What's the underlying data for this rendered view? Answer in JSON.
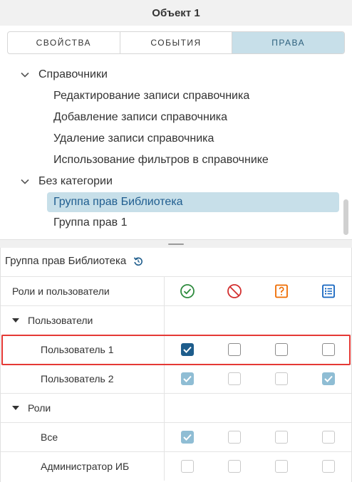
{
  "header": {
    "title": "Объект 1"
  },
  "tabs": [
    {
      "label": "СВОЙСТВА",
      "active": false
    },
    {
      "label": "СОБЫТИЯ",
      "active": false
    },
    {
      "label": "ПРАВА",
      "active": true
    }
  ],
  "tree": {
    "groups": [
      {
        "label": "Справочники",
        "items": [
          "Редактирование записи справочника",
          "Добавление записи справочника",
          "Удаление записи справочника",
          "Использование фильтров в справочнике"
        ]
      },
      {
        "label": "Без категории",
        "items": [
          "Группа прав Библиотека",
          "Группа прав 1"
        ],
        "selected_item": "Группа прав Библиотека"
      }
    ]
  },
  "panel": {
    "title": "Группа прав Библиотека",
    "columns_header": "Роли и пользователи",
    "column_icons": [
      "allow-icon",
      "deny-icon",
      "ask-icon",
      "list-icon"
    ],
    "colors": {
      "allow": "#2e8b3e",
      "deny": "#d32f2f",
      "ask": "#ef6c00",
      "list": "#1565c0",
      "accent": "#1e5d8c",
      "highlight": "#e53935"
    },
    "rows": [
      {
        "type": "group",
        "label": "Пользователи"
      },
      {
        "type": "item",
        "label": "Пользователь 1",
        "checks": [
          true,
          false,
          false,
          false
        ],
        "dim": false,
        "highlighted": true
      },
      {
        "type": "item",
        "label": "Пользователь 2",
        "checks": [
          true,
          false,
          false,
          true
        ],
        "dim": true
      },
      {
        "type": "group",
        "label": "Роли"
      },
      {
        "type": "item",
        "label": "Все",
        "checks": [
          true,
          false,
          false,
          false
        ],
        "dim": true
      },
      {
        "type": "item",
        "label": "Администратор ИБ",
        "checks": [
          false,
          false,
          false,
          false
        ],
        "dim": true
      }
    ]
  }
}
